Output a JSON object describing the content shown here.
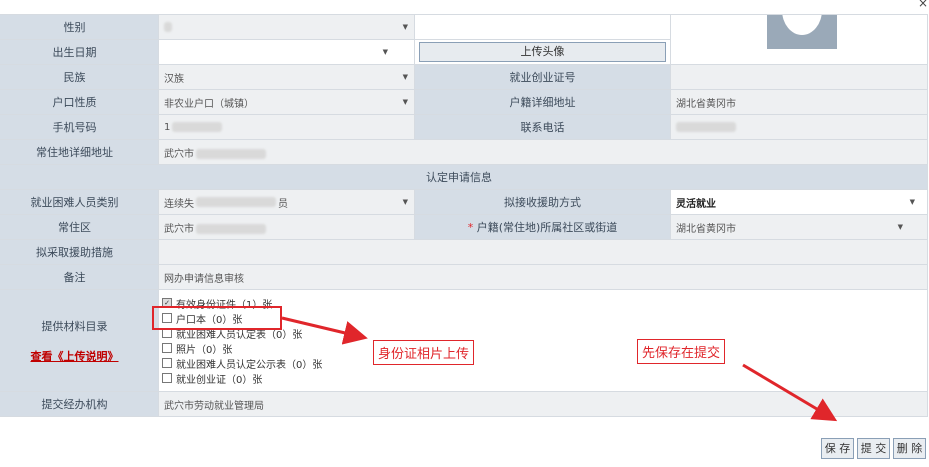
{
  "window": {
    "close_glyph": "×"
  },
  "rows": {
    "gender": {
      "label": "性别",
      "value": ""
    },
    "birth": {
      "label": "出生日期",
      "upload_photo": "上传头像"
    },
    "ethnic": {
      "label": "民族",
      "value": "汉族",
      "cert_label": "就业创业证号"
    },
    "hukou_type": {
      "label": "户口性质",
      "value": "非农业户口（城镇）",
      "addr_label": "户籍详细地址",
      "addr_value": "湖北省黄冈市"
    },
    "phone": {
      "label": "手机号码",
      "value": "1",
      "tel_label": "联系电话"
    },
    "residence": {
      "label": "常住地详细地址",
      "value": "武穴市"
    }
  },
  "section": {
    "title": "认定申请信息"
  },
  "apply": {
    "category": {
      "label": "就业困难人员类别",
      "value_prefix": "连续失",
      "value_suffix": "员"
    },
    "assist_label": "拟接收援助方式",
    "assist_value": "灵活就业",
    "area": {
      "label": "常住区",
      "value": "武穴市"
    },
    "community_star": "*",
    "community_label": "户籍(常住地)所属社区或街道",
    "community_value": "湖北省黄冈市",
    "measures": {
      "label": "拟采取援助措施"
    },
    "remark": {
      "label": "备注",
      "value": "网办申请信息审核"
    },
    "materials": {
      "label": "提供材料目录",
      "link": "查看《上传说明》",
      "items": [
        {
          "text": "有效身份证件（1）张",
          "checked": true
        },
        {
          "text": "户口本（0）张",
          "checked": false
        },
        {
          "text": "就业困难人员认定表（0）张",
          "checked": false
        },
        {
          "text": "照片（0）张",
          "checked": false
        },
        {
          "text": "就业困难人员认定公示表（0）张",
          "checked": false
        },
        {
          "text": "就业创业证（0）张",
          "checked": false
        }
      ]
    },
    "agency": {
      "label": "提交经办机构",
      "value": "武穴市劳动就业管理局"
    }
  },
  "annotations": {
    "id_upload": "身份证相片上传",
    "save_first": "先保存在提交",
    "colors": {
      "annotation": "#e0262b",
      "label_bg": "#d5dde6",
      "field_bg": "#eef0f2"
    }
  },
  "buttons": {
    "save": "保 存",
    "submit": "提 交",
    "delete": "删 除"
  }
}
